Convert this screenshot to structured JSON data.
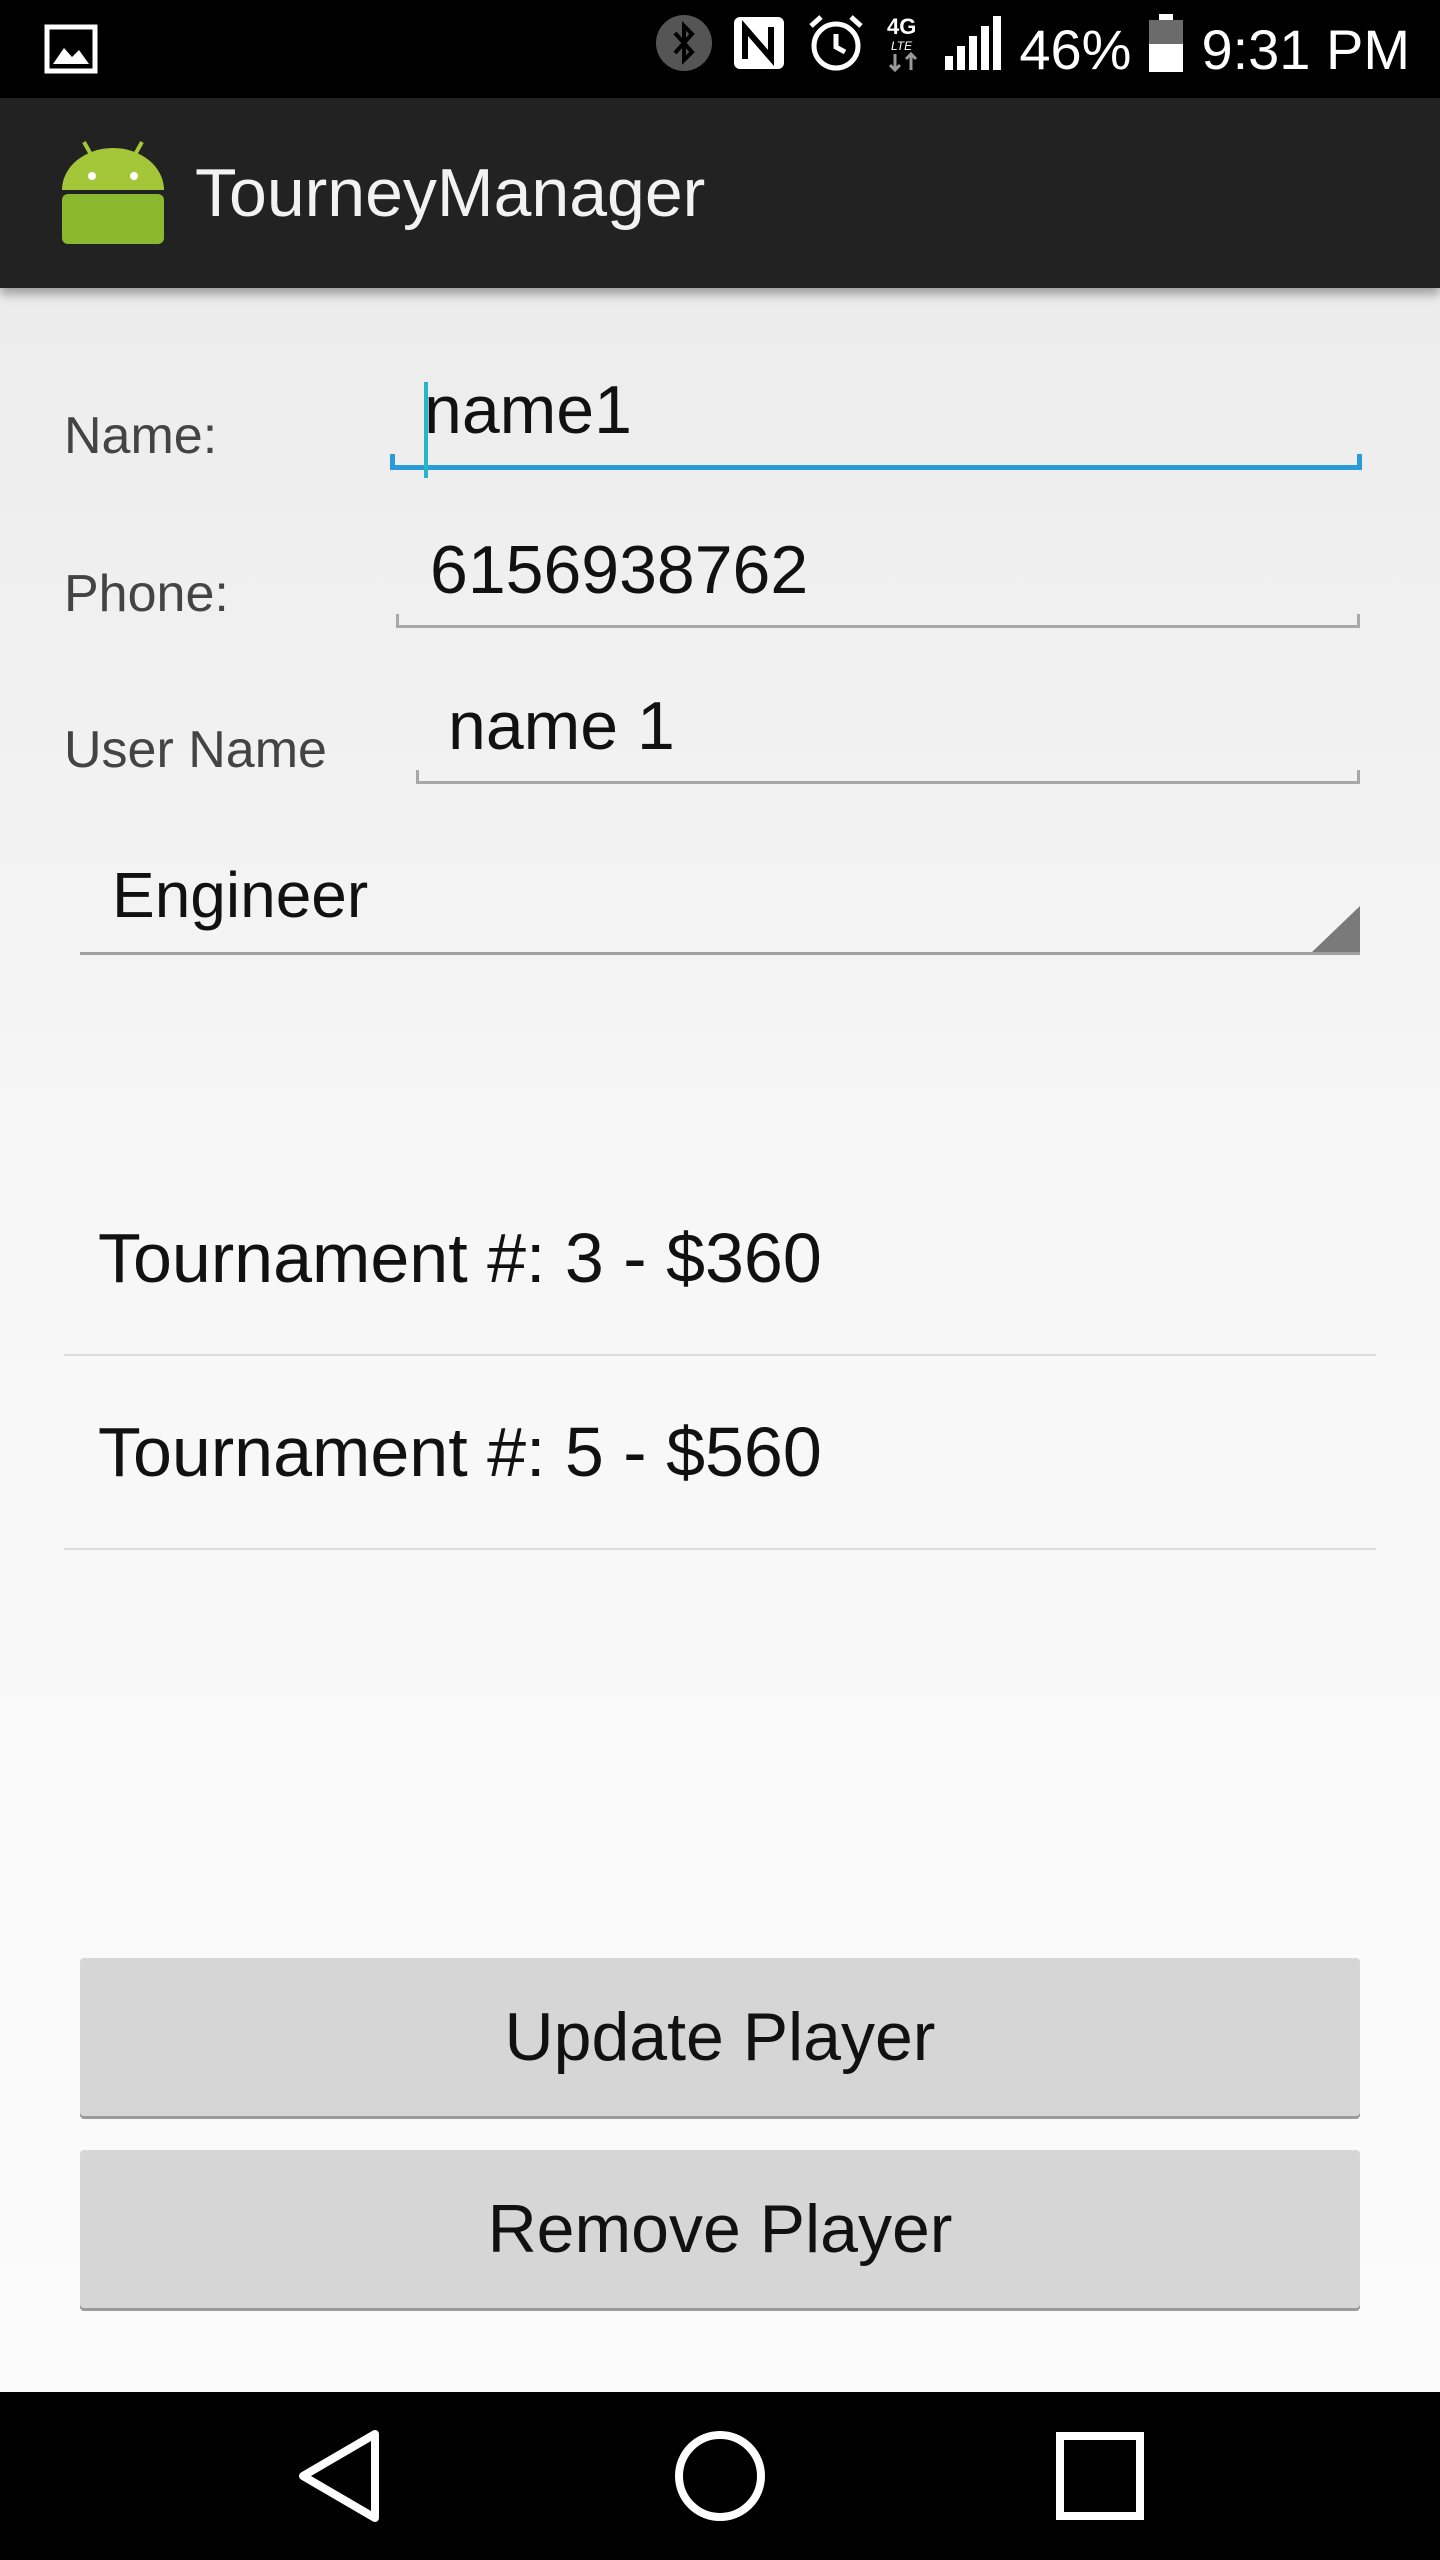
{
  "status_bar": {
    "battery_percent": "46%",
    "time": "9:31 PM",
    "icons": [
      "gallery-icon",
      "bluetooth-icon",
      "nfc-icon",
      "alarm-icon",
      "4g-lte-icon",
      "signal-icon",
      "battery-icon"
    ]
  },
  "action_bar": {
    "title": "TourneyManager",
    "logo_icon": "android-logo-icon"
  },
  "form": {
    "name_label": "Name:",
    "name_value": "name1",
    "phone_label": "Phone:",
    "phone_value": "6156938762",
    "username_label": "User Name",
    "username_value": "name 1",
    "role_selected": "Engineer"
  },
  "tournaments": [
    {
      "label": "Tournament #: 3 - $360"
    },
    {
      "label": "Tournament #: 5 - $560"
    }
  ],
  "buttons": {
    "update_label": "Update Player",
    "remove_label": "Remove Player"
  },
  "nav_bar": {
    "icons": [
      "back-icon",
      "home-icon",
      "recents-icon"
    ]
  },
  "colors": {
    "accent": "#2a9bd8",
    "cursor": "#26b6c6",
    "action_bar": "#222222",
    "android_green": "#a4c639"
  }
}
